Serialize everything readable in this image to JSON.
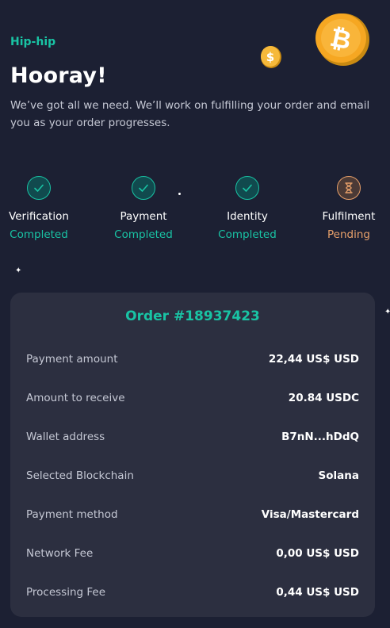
{
  "header": {
    "eyebrow": "Hip-hip",
    "title": "Hooray!",
    "subtitle": "We’ve got all we need. We’ll work on fulfilling your order and email you as your order progresses."
  },
  "steps": [
    {
      "label": "Verification",
      "status": "Completed",
      "icon": "check-icon"
    },
    {
      "label": "Payment",
      "status": "Completed",
      "icon": "check-icon"
    },
    {
      "label": "Identity",
      "status": "Completed",
      "icon": "check-icon"
    },
    {
      "label": "Fulfilment",
      "status": "Pending",
      "icon": "hourglass-icon"
    }
  ],
  "order": {
    "title": "Order #18937423",
    "rows": [
      {
        "label": "Payment amount",
        "value": "22,44 US$ USD"
      },
      {
        "label": "Amount to receive",
        "value": "20.84 USDC"
      },
      {
        "label": "Wallet address",
        "value": "B7nN...hDdQ"
      },
      {
        "label": "Selected Blockchain",
        "value": "Solana"
      },
      {
        "label": "Payment method",
        "value": "Visa/Mastercard"
      },
      {
        "label": "Network Fee",
        "value": "0,00 US$ USD"
      },
      {
        "label": "Processing Fee",
        "value": "0,44 US$ USD"
      }
    ]
  },
  "colors": {
    "background": "#1c2033",
    "card": "#2c2f40",
    "accent": "#19c3a4",
    "pending": "#e8a06a"
  },
  "decorations": {
    "coins": [
      "dollar-coin-icon",
      "bitcoin-coin-icon"
    ]
  }
}
